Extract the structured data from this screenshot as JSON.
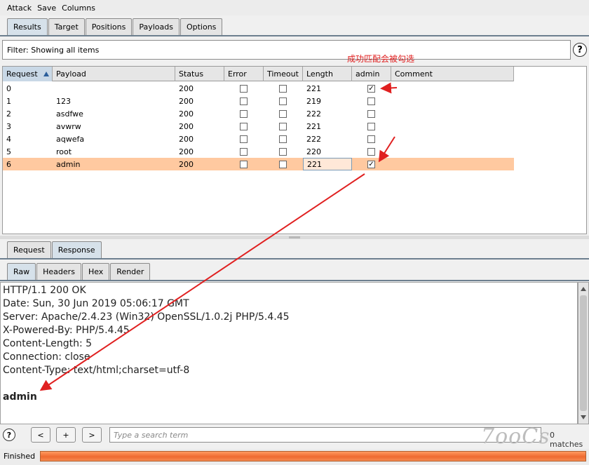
{
  "menu": {
    "items": [
      "Attack",
      "Save",
      "Columns"
    ]
  },
  "main_tabs": [
    {
      "label": "Results",
      "active": true
    },
    {
      "label": "Target",
      "active": false
    },
    {
      "label": "Positions",
      "active": false
    },
    {
      "label": "Payloads",
      "active": false
    },
    {
      "label": "Options",
      "active": false
    }
  ],
  "filter": {
    "text": "Filter:  Showing all items"
  },
  "annotation": "成功匹配会被勾选",
  "table": {
    "columns": [
      "Request",
      "Payload",
      "Status",
      "Error",
      "Timeout",
      "Length",
      "admin",
      "Comment"
    ],
    "rows": [
      {
        "request": "0",
        "payload": "",
        "status": "200",
        "error": false,
        "timeout": false,
        "length": "221",
        "admin": true,
        "comment": ""
      },
      {
        "request": "1",
        "payload": "123",
        "status": "200",
        "error": false,
        "timeout": false,
        "length": "219",
        "admin": false,
        "comment": ""
      },
      {
        "request": "2",
        "payload": "asdfwe",
        "status": "200",
        "error": false,
        "timeout": false,
        "length": "222",
        "admin": false,
        "comment": ""
      },
      {
        "request": "3",
        "payload": "avwrw",
        "status": "200",
        "error": false,
        "timeout": false,
        "length": "221",
        "admin": false,
        "comment": ""
      },
      {
        "request": "4",
        "payload": "aqwefa",
        "status": "200",
        "error": false,
        "timeout": false,
        "length": "222",
        "admin": false,
        "comment": ""
      },
      {
        "request": "5",
        "payload": "root",
        "status": "200",
        "error": false,
        "timeout": false,
        "length": "220",
        "admin": false,
        "comment": ""
      },
      {
        "request": "6",
        "payload": "admin",
        "status": "200",
        "error": false,
        "timeout": false,
        "length": "221",
        "admin": true,
        "comment": "",
        "selected": true
      }
    ]
  },
  "req_resp_tabs": [
    {
      "label": "Request",
      "active": false
    },
    {
      "label": "Response",
      "active": true
    }
  ],
  "view_tabs": [
    {
      "label": "Raw",
      "active": true
    },
    {
      "label": "Headers",
      "active": false
    },
    {
      "label": "Hex",
      "active": false
    },
    {
      "label": "Render",
      "active": false
    }
  ],
  "response": {
    "headers": [
      "HTTP/1.1 200 OK",
      "Date: Sun, 30 Jun 2019 05:06:17 GMT",
      "Server: Apache/2.4.23 (Win32) OpenSSL/1.0.2j PHP/5.4.45",
      "X-Powered-By: PHP/5.4.45",
      "Content-Length: 5",
      "Connection: close",
      "Content-Type: text/html;charset=utf-8"
    ],
    "body": "admin"
  },
  "search": {
    "help": "?",
    "prev": "<",
    "add": "+",
    "next": ">",
    "placeholder": "Type a search term",
    "matches": "0 matches"
  },
  "watermark": "7ooCs",
  "status": {
    "label": "Finished",
    "progress": 1.0
  },
  "colors": {
    "annotation": "#e02020",
    "selected_row": "#ffc9a0",
    "progress": "#ef6a30"
  }
}
